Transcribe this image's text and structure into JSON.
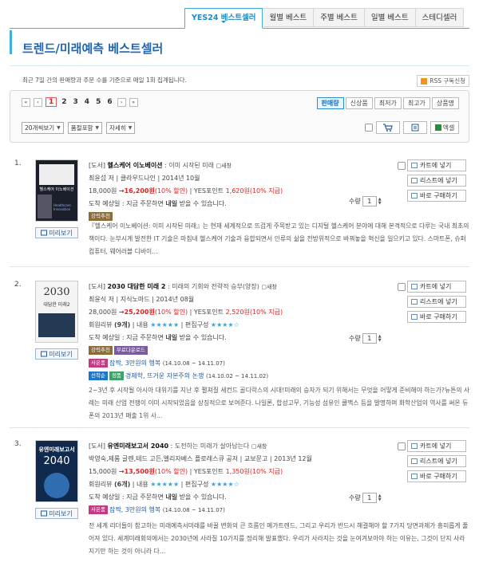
{
  "tabs": [
    "YES24 베스트셀러",
    "월별 베스트",
    "주별 베스트",
    "일별 베스트",
    "스테디셀러"
  ],
  "page_title": "트렌드/미래예측 베스트셀러",
  "description": "최근 7일 간의 판매량과 주문 수를 기준으로 매일 1회 집계됩니다.",
  "rss_label": "RSS 구독신청",
  "pager": {
    "first": "«",
    "prev": "‹",
    "pages": [
      "1",
      "2",
      "3",
      "4",
      "5",
      "6"
    ],
    "current": "1",
    "next": "›",
    "last": "»"
  },
  "sort_buttons": [
    "판매량",
    "신상품",
    "최저가",
    "최고가",
    "상품명"
  ],
  "selects": [
    "20개씩보기",
    "품절포함",
    "자세히"
  ],
  "excel_label": "엑셀",
  "item_buttons": {
    "cart": "카트에 넣기",
    "list": "리스트에 넣기",
    "buy": "바로 구매하기"
  },
  "qty_label": "수량",
  "preview_label": "미리보기",
  "items": [
    {
      "rank": "1.",
      "category": "[도서]",
      "title": "헬스케어 이노베이션",
      "subtitle": " : 이미 시작된 미래",
      "new_window": "새창",
      "author_line": "최윤섭 저 | 클라우드나인 | 2014년 10월",
      "price_orig": "18,000원",
      "price_sale": "16,200원",
      "discount": "(10% 할인)",
      "points_label": "YES포인트",
      "points": "1,620원",
      "points_rate": "(10% 지급)",
      "delivery_prefix": "도착 예상일 : 지금 주문하면 ",
      "delivery_day": "내일",
      "delivery_suffix": " 받을 수 있습니다.",
      "badges": [
        "강력추천"
      ],
      "summary": "『헬스케어 이노베이션: 이미 시작된 미래』는 현재 세계적으로 뜨겁게 주목받고 있는 디지털 헬스케어 분야에 대해 본격적으로 다루는 국내 최초의 책이다. 눈부시게 발전한 IT 기술은 마침내 헬스케어 기술과 융합되면서 인류의 삶을 전방위적으로 바꿔놓을 혁신을 일으키고 있다. 스마트폰, 슈퍼컴퓨터, 웨어러블 디바이...",
      "qty": "1",
      "cover_text": "헬스케어 이노베이션",
      "cover_sub": "Healthcare Innovation"
    },
    {
      "rank": "2.",
      "category": "[도서]",
      "title": "2030 대담한 미래 2",
      "subtitle": " : 미래의 기회와 전략적 승부(양장)",
      "new_window": "새창",
      "author_line": "최윤식 저 | 지식노마드 | 2014년 08월",
      "price_orig": "28,000원",
      "price_sale": "25,200원",
      "discount": "(10% 할인)",
      "points_label": "YES포인트",
      "points": "2,520원",
      "points_rate": "(10% 지급)",
      "review_prefix": "회원리뷰 ",
      "review_count": "(9개)",
      "content_label": " | 내용 ",
      "content_stars": "★★★★★",
      "edit_label": " | 편집구성 ",
      "edit_stars": "★★★★☆",
      "delivery_prefix": "도착 예상일 : 지금 주문하면 ",
      "delivery_day": "내일",
      "delivery_suffix": " 받을 수 있습니다.",
      "badges": [
        "강력추천",
        "무료다운로드"
      ],
      "promo1_badge": "사은품",
      "promo1_text": "잠짝, 3만원의 행복 ",
      "promo1_date": "(14.10.08 ~ 14.11.07)",
      "promo2_badges": [
        "선착순",
        "정품"
      ],
      "promo2_text": "경제학, 뜨거운 자본주의 논쟁 ",
      "promo2_date": "(14.10.02 ~ 14.11.02)",
      "summary": "2~3년 후 시작될 아시아 대위기를 지난 후 펼쳐질 세컨드 골디락스의 시대!미래의 승자가 되기 위해서는 무엇을 어떻게 준비해야 하는가?뉴튼의 사례는 미래 산업 전쟁이 이미 시작되었음을 상징적으로 보여준다. 나일론, 합성고무, 기능성 섬유인 쿨맥스 등을 발명하며 화학산업의 역사를 써온 듀폰의 2013년 매출 1위 사...",
      "qty": "1",
      "cover_text": "2030",
      "cover_sub": "대담한 미래2"
    },
    {
      "rank": "3.",
      "category": "[도서]",
      "title": "유엔미래보고서 2040",
      "subtitle": " : 도전하는 미래가 살아남는다",
      "new_window": "새창",
      "author_line": "박영숙,제롬 글렌,테드 고든,엘리자베스 플로레스큐 공저 | 교보문고 | 2013년 12월",
      "price_orig": "15,000원",
      "price_sale": "13,500원",
      "discount": "(10% 할인)",
      "points_label": "YES포인트",
      "points": "1,350원",
      "points_rate": "(10% 지급)",
      "review_prefix": "회원리뷰 ",
      "review_count": "(6개)",
      "content_label": " | 내용 ",
      "content_stars": "★★★★★",
      "edit_label": " | 편집구성 ",
      "edit_stars": "★★★★☆",
      "delivery_prefix": "도착 예상일 : 지금 주문하면 ",
      "delivery_day": "내일",
      "delivery_suffix": " 받을 수 있습니다.",
      "promo1_badge": "사은품",
      "promo1_text": "잠짝, 3만원의 행복 ",
      "promo1_date": "(14.10.08 ~ 14.11.07)",
      "summary": "전 세계 리더들이 참고하는 미래예측서미래를 바꿀 변화의 큰 흐름인 메가트렌드, 그리고 우리가 반드시 해결해야 할 7가지 당면과제가 흥미롭게 풀어져 있다. 세계미래회의에서는 2030년에 사라질 10가지를 정리해 발표했다. 우리가 사라지는 것을 눈여겨보아야 하는 이유는, 그것이 단지 사라지기만 하는 것이 아니라 다...",
      "qty": "1",
      "cover_text": "유엔미래보고서",
      "cover_sub": "2040"
    }
  ]
}
